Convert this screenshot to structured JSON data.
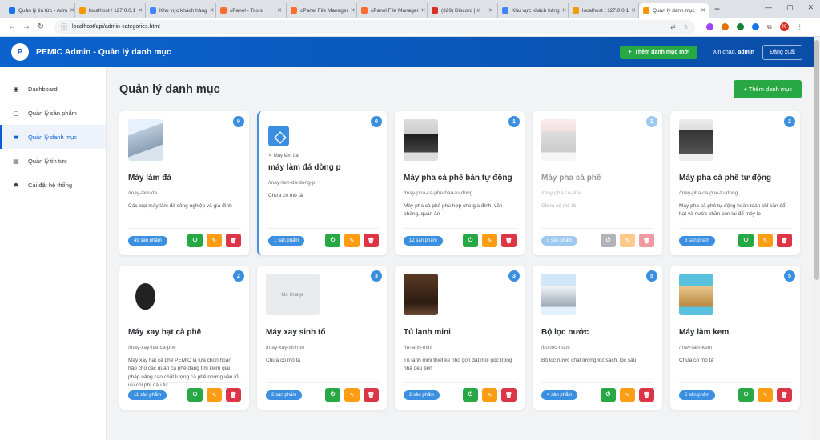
{
  "browser": {
    "tabs": [
      {
        "title": "Quản lý tin tức - Adm",
        "fav": "#1a73e8"
      },
      {
        "title": "localhost / 127.0.0.1",
        "fav": "#f29900"
      },
      {
        "title": "Khu vực khách hàng",
        "fav": "#4285f4"
      },
      {
        "title": "cPanel - Tools",
        "fav": "#ff6c2c"
      },
      {
        "title": "cPanel File Manager",
        "fav": "#ff6c2c"
      },
      {
        "title": "cPanel File Manager",
        "fav": "#ff6c2c"
      },
      {
        "title": "(329) Discord | #",
        "fav": "#d93025"
      },
      {
        "title": "Khu vực khách hàng",
        "fav": "#4285f4"
      },
      {
        "title": "localhost / 127.0.0.1",
        "fav": "#f29900"
      },
      {
        "title": "Quản lý danh mục",
        "fav": "#f29900",
        "active": true
      }
    ],
    "url": "localhost/api/admin-categories.html",
    "profile_initial": "K"
  },
  "header": {
    "logo": "P",
    "title": "PEMIC Admin - Quản lý danh mục",
    "add_button": "Thêm danh mục mới",
    "welcome_prefix": "Xin chào,",
    "username": "admin",
    "logout": "Đăng xuất"
  },
  "sidebar": {
    "items": [
      {
        "label": "Dashboard",
        "icon": "dashboard-icon",
        "glyph": "◉"
      },
      {
        "label": "Quản lý sản phẩm",
        "icon": "box-icon",
        "glyph": "▢"
      },
      {
        "label": "Quản lý danh mục",
        "icon": "folder-icon",
        "glyph": "■",
        "active": true
      },
      {
        "label": "Quản lý tin tức",
        "icon": "newspaper-icon",
        "glyph": "▤"
      },
      {
        "label": "Cài đặt hệ thống",
        "icon": "gear-icon",
        "glyph": "✹"
      }
    ]
  },
  "main": {
    "title": "Quản lý danh mục",
    "add_button": "+ Thêm danh mục"
  },
  "categories": [
    {
      "name": "Máy làm đá",
      "slug": "/may-lam-da",
      "desc": "Các loại máy làm đá công nghiệp và gia đình",
      "count": "49 sản phẩm",
      "badge": "0",
      "pic": "pic1"
    },
    {
      "name": "máy làm đá dòng p",
      "slug": "/may-lam-da-dong-p",
      "desc": "Chưa có mô tả",
      "count": "1 sản phẩm",
      "badge": "0",
      "parent": "↳ Máy làm đá",
      "cube": true,
      "hl": true
    },
    {
      "name": "Máy pha cà phê bán tự động",
      "slug": "/may-pha-ca-phe-ban-tu-dong",
      "desc": "Máy pha cà phê phù hợp cho gia đình, văn phòng, quán ăn",
      "count": "12 sản phẩm",
      "badge": "1",
      "pic": "pic2"
    },
    {
      "name": "Máy pha cà phê",
      "slug": "/may-pha-ca-phe",
      "desc": "Chưa có mô tả",
      "count": "0 sản phẩm",
      "badge": "2",
      "pic": "pic3",
      "dim": true
    },
    {
      "name": "Máy pha cà phê tự động",
      "slug": "/may-pha-ca-phe-tu-dong",
      "desc": "Máy pha cà phê tự động hoàn toàn chỉ cần đổ hạt và nước phần còn lại để máy lo",
      "count": "3 sản phẩm",
      "badge": "2",
      "pic": "pic4"
    },
    {
      "name": "Máy xay hạt cà phê",
      "slug": "/may-xay-hat-ca-phe",
      "desc": "Máy xay hạt cà phê PEMIC là lựa chọn hoàn hảo cho các quán cà phê đang tìm kiếm giải pháp nâng cao chất lượng cà phê nhưng vẫn tối ưu chi phí đầu tư.",
      "count": "11 sản phẩm",
      "badge": "2",
      "pic": "pic5"
    },
    {
      "name": "Máy xay sinh tố",
      "slug": "/may-xay-sinh-to",
      "desc": "Chưa có mô tả",
      "count": "2 sản phẩm",
      "badge": "3",
      "noimg": "No Image"
    },
    {
      "name": "Tủ lạnh mini",
      "slug": "/tu-lanh-mini",
      "desc": "Tủ lạnh mini thiết kế nhỏ gọn đặt mọi góc trong nhà đều tiện",
      "count": "2 sản phẩm",
      "badge": "3",
      "pic": "pic6"
    },
    {
      "name": "Bộ lọc nước",
      "slug": "/bo-loc-nuoc",
      "desc": "Bộ lọc nước chất lượng lọc sạch, lọc sâu",
      "count": "4 sản phẩm",
      "badge": "5",
      "pic": "pic7"
    },
    {
      "name": "Máy làm kem",
      "slug": "/may-lam-kem",
      "desc": "Chưa có mô tả",
      "count": "6 sản phẩm",
      "badge": "5",
      "pic": "pic8"
    }
  ],
  "actions": {
    "toggle": "⏻",
    "edit": "✎",
    "delete": "🗑"
  }
}
